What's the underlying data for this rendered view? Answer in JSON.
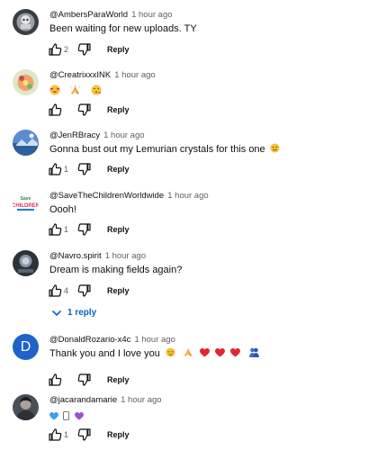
{
  "comments": [
    {
      "author": "@AmbersParaWorld",
      "time": "1 hour ago",
      "text": "Been waiting for new uploads. TY",
      "likes": "2",
      "reply": "Reply"
    },
    {
      "author": "@CreatrixxxINK",
      "time": "1 hour ago",
      "emojis": [
        "face-with-heart-eyes",
        "folded-hands",
        "face-blowing-kiss"
      ],
      "likes": "",
      "reply": "Reply"
    },
    {
      "author": "@JenRBracy",
      "time": "1 hour ago",
      "text": "Gonna bust out my Lemurian crystals for this one",
      "emoji_after": "winking-face",
      "likes": "1",
      "reply": "Reply"
    },
    {
      "author": "@SaveTheChildrenWorldwide",
      "time": "1 hour ago",
      "text": "Oooh!",
      "likes": "1",
      "reply": "Reply"
    },
    {
      "author": "@Navro.spirit",
      "time": "1 hour ago",
      "text": "Dream is making fields again?",
      "likes": "4",
      "reply": "Reply",
      "replies_toggle": "1 reply"
    },
    {
      "author": "@DonaldRozario-x4c",
      "time": "1 hour ago",
      "avatar_letter": "D",
      "avatar_color": "#1e63c9",
      "text": "Thank you and I love you",
      "emojis_after": [
        "relieved-face",
        "folded-hands",
        "red-heart",
        "red-heart",
        "red-heart",
        "people-hugging"
      ],
      "likes": "",
      "reply": "Reply"
    },
    {
      "author": "@jacarandamarie",
      "time": "1 hour ago",
      "emojis": [
        "blue-heart",
        "white-heart",
        "purple-heart"
      ],
      "likes": "1",
      "reply": "Reply"
    }
  ]
}
